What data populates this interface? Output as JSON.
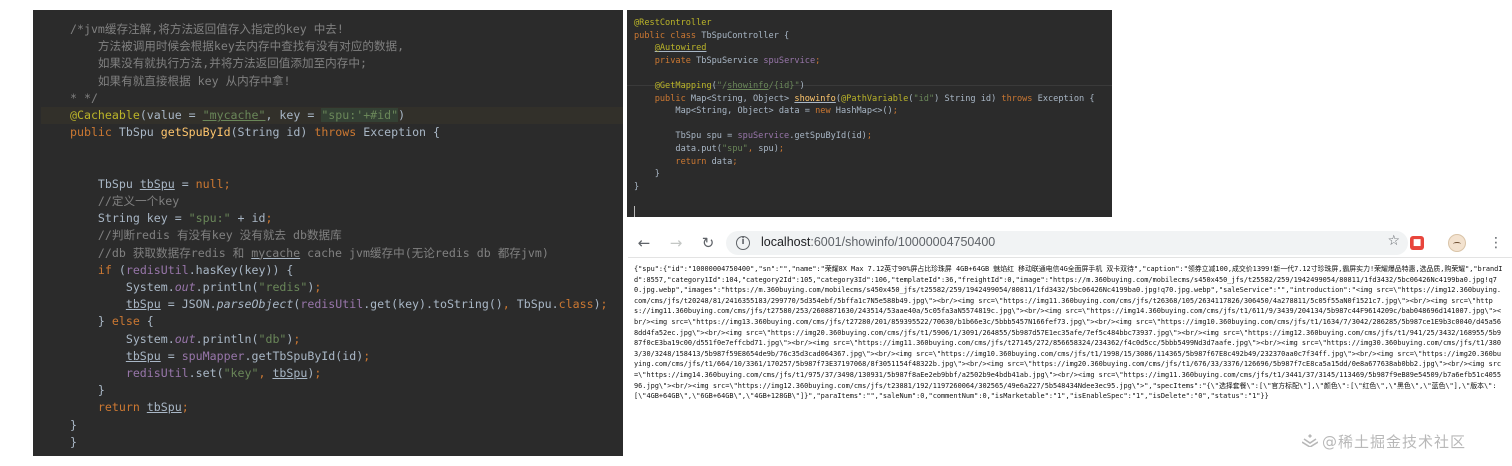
{
  "left_editor": {
    "lines": [
      {
        "parts": [
          {
            "t": "/*jvm缓存注解,将方法返回值存入指定的key 中去!",
            "c": "c-cmt"
          }
        ]
      },
      {
        "parts": [
          {
            "t": "    方法被调用时候会根据key去内存中查找有没有对应的数据,",
            "c": "c-cmt"
          }
        ]
      },
      {
        "parts": [
          {
            "t": "    如果没有就执行方法,并将方法返回值添加至内存中;",
            "c": "c-cmt"
          }
        ]
      },
      {
        "parts": [
          {
            "t": "    如果有就直接根据 key 从内存中拿!",
            "c": "c-cmt"
          }
        ]
      },
      {
        "parts": [
          {
            "t": "* */",
            "c": "c-cmt"
          }
        ]
      },
      {
        "parts": [
          {
            "t": "@Cacheable",
            "c": "c-ann"
          },
          {
            "t": "(value = ",
            "c": ""
          },
          {
            "t": "\"mycache\"",
            "c": "c-str c-ul-str"
          },
          {
            "t": ", key = ",
            "c": ""
          },
          {
            "t": "\"spu:'+#id\"",
            "c": "c-key"
          },
          {
            "t": ")",
            "c": ""
          }
        ]
      },
      {
        "parts": [
          {
            "t": "public ",
            "c": "c-kw"
          },
          {
            "t": "TbSpu ",
            "c": ""
          },
          {
            "t": "getSpuById",
            "c": "c-fn"
          },
          {
            "t": "(String id) ",
            "c": ""
          },
          {
            "t": "throws ",
            "c": "c-kw"
          },
          {
            "t": "Exception {",
            "c": ""
          }
        ]
      },
      {
        "parts": []
      },
      {
        "parts": []
      },
      {
        "parts": [
          {
            "t": "    TbSpu ",
            "c": ""
          },
          {
            "t": "tbSpu",
            "c": "c-ul"
          },
          {
            "t": " = ",
            "c": ""
          },
          {
            "t": "null",
            "c": "c-kw"
          },
          {
            "t": ";",
            "c": "c-kw"
          }
        ]
      },
      {
        "parts": [
          {
            "t": "    //定义一个key",
            "c": "c-cmt"
          }
        ]
      },
      {
        "parts": [
          {
            "t": "    String key = ",
            "c": ""
          },
          {
            "t": "\"spu:\"",
            "c": "c-str"
          },
          {
            "t": " + id",
            "c": ""
          },
          {
            "t": ";",
            "c": "c-kw"
          }
        ]
      },
      {
        "parts": [
          {
            "t": "    //判断redis 有没有key 没有就去 db数据库",
            "c": "c-cmt"
          }
        ]
      },
      {
        "parts": [
          {
            "t": "    //db 获取数据存redis 和 ",
            "c": "c-cmt"
          },
          {
            "t": "mycache",
            "c": "c-cmt c-ul"
          },
          {
            "t": " cache jvm缓存中(无论redis db 都存jvm)",
            "c": "c-cmt"
          }
        ]
      },
      {
        "parts": [
          {
            "t": "    ",
            "c": ""
          },
          {
            "t": "if ",
            "c": "c-kw"
          },
          {
            "t": "(",
            "c": ""
          },
          {
            "t": "redisUtil",
            "c": "c-fld"
          },
          {
            "t": ".hasKey(key)) {",
            "c": ""
          }
        ]
      },
      {
        "parts": [
          {
            "t": "        System.",
            "c": ""
          },
          {
            "t": "out",
            "c": "c-fld c-it"
          },
          {
            "t": ".println(",
            "c": ""
          },
          {
            "t": "\"redis\"",
            "c": "c-str"
          },
          {
            "t": ")",
            "c": ""
          },
          {
            "t": ";",
            "c": "c-kw"
          }
        ]
      },
      {
        "parts": [
          {
            "t": "        ",
            "c": ""
          },
          {
            "t": "tbSpu",
            "c": "c-ul"
          },
          {
            "t": " = JSON.",
            "c": ""
          },
          {
            "t": "parseObject",
            "c": "c-it"
          },
          {
            "t": "(",
            "c": ""
          },
          {
            "t": "redisUtil",
            "c": "c-fld"
          },
          {
            "t": ".get(key).toString()",
            "c": ""
          },
          {
            "t": ", ",
            "c": "c-kw"
          },
          {
            "t": "TbSpu.",
            "c": ""
          },
          {
            "t": "class",
            "c": "c-kw"
          },
          {
            "t": ")",
            "c": ""
          },
          {
            "t": ";",
            "c": "c-kw"
          }
        ]
      },
      {
        "parts": [
          {
            "t": "    } ",
            "c": ""
          },
          {
            "t": "else ",
            "c": "c-kw"
          },
          {
            "t": "{",
            "c": ""
          }
        ]
      },
      {
        "parts": [
          {
            "t": "        System.",
            "c": ""
          },
          {
            "t": "out",
            "c": "c-fld c-it"
          },
          {
            "t": ".println(",
            "c": ""
          },
          {
            "t": "\"db\"",
            "c": "c-str"
          },
          {
            "t": ")",
            "c": ""
          },
          {
            "t": ";",
            "c": "c-kw"
          }
        ]
      },
      {
        "parts": [
          {
            "t": "        ",
            "c": ""
          },
          {
            "t": "tbSpu",
            "c": "c-ul"
          },
          {
            "t": " = ",
            "c": ""
          },
          {
            "t": "spuMapper",
            "c": "c-fld"
          },
          {
            "t": ".getTbSpuById(id)",
            "c": ""
          },
          {
            "t": ";",
            "c": "c-kw"
          }
        ]
      },
      {
        "parts": [
          {
            "t": "        ",
            "c": ""
          },
          {
            "t": "redisUtil",
            "c": "c-fld"
          },
          {
            "t": ".set(",
            "c": ""
          },
          {
            "t": "\"key\"",
            "c": "c-str"
          },
          {
            "t": ", ",
            "c": "c-kw"
          },
          {
            "t": "tbSpu",
            "c": "c-ul"
          },
          {
            "t": ")",
            "c": ""
          },
          {
            "t": ";",
            "c": "c-kw"
          }
        ]
      },
      {
        "parts": [
          {
            "t": "    }",
            "c": ""
          }
        ]
      },
      {
        "parts": [
          {
            "t": "    ",
            "c": ""
          },
          {
            "t": "return ",
            "c": "c-kw"
          },
          {
            "t": "tbSpu",
            "c": "c-ul"
          },
          {
            "t": ";",
            "c": "c-kw"
          }
        ]
      },
      {
        "parts": [
          {
            "t": "}",
            "c": ""
          }
        ]
      },
      {
        "parts": [
          {
            "t": "}",
            "c": ""
          }
        ]
      }
    ]
  },
  "right_editor": {
    "lines": [
      {
        "parts": [
          {
            "t": "@RestController",
            "c": "c-ann"
          }
        ]
      },
      {
        "parts": [
          {
            "t": "public class ",
            "c": "c-kw"
          },
          {
            "t": "TbSpuController {",
            "c": ""
          }
        ]
      },
      {
        "parts": [
          {
            "t": "    ",
            "c": ""
          },
          {
            "t": "@Autowired",
            "c": "c-ann c-ul"
          }
        ]
      },
      {
        "parts": [
          {
            "t": "    ",
            "c": ""
          },
          {
            "t": "private ",
            "c": "c-kw"
          },
          {
            "t": "TbSpuService ",
            "c": ""
          },
          {
            "t": "spuService",
            "c": "c-fld"
          },
          {
            "t": ";",
            "c": "c-kw"
          }
        ]
      },
      {
        "parts": []
      },
      {
        "parts": [
          {
            "t": "    ",
            "c": ""
          },
          {
            "t": "@GetMapping",
            "c": "c-ann"
          },
          {
            "t": "(",
            "c": ""
          },
          {
            "t": "\"/",
            "c": "c-str"
          },
          {
            "t": "showinfo",
            "c": "c-str c-ul-str"
          },
          {
            "t": "/{id}\"",
            "c": "c-str"
          },
          {
            "t": ")",
            "c": ""
          }
        ]
      },
      {
        "parts": [
          {
            "t": "    ",
            "c": ""
          },
          {
            "t": "public ",
            "c": "c-kw"
          },
          {
            "t": "Map<String, Object> ",
            "c": ""
          },
          {
            "t": "showinfo",
            "c": "c-fn c-ul"
          },
          {
            "t": "(",
            "c": ""
          },
          {
            "t": "@PathVariable",
            "c": "c-ann"
          },
          {
            "t": "(",
            "c": ""
          },
          {
            "t": "\"id\"",
            "c": "c-str"
          },
          {
            "t": ") String id) ",
            "c": ""
          },
          {
            "t": "throws ",
            "c": "c-kw"
          },
          {
            "t": "Exception {",
            "c": ""
          }
        ]
      },
      {
        "parts": [
          {
            "t": "        Map<String, Object> data = ",
            "c": ""
          },
          {
            "t": "new ",
            "c": "c-kw"
          },
          {
            "t": "HashMap<>()",
            "c": ""
          },
          {
            "t": ";",
            "c": "c-kw"
          }
        ]
      },
      {
        "parts": []
      },
      {
        "parts": [
          {
            "t": "        TbSpu spu = ",
            "c": ""
          },
          {
            "t": "spuService",
            "c": "c-fld"
          },
          {
            "t": ".getSpuById(id)",
            "c": ""
          },
          {
            "t": ";",
            "c": "c-kw"
          }
        ]
      },
      {
        "parts": [
          {
            "t": "        data.put(",
            "c": ""
          },
          {
            "t": "\"spu\"",
            "c": "c-str"
          },
          {
            "t": ", ",
            "c": "c-kw"
          },
          {
            "t": "spu)",
            "c": ""
          },
          {
            "t": ";",
            "c": "c-kw"
          }
        ]
      },
      {
        "parts": [
          {
            "t": "        ",
            "c": ""
          },
          {
            "t": "return ",
            "c": "c-kw"
          },
          {
            "t": "data",
            "c": ""
          },
          {
            "t": ";",
            "c": "c-kw"
          }
        ]
      },
      {
        "parts": [
          {
            "t": "    }",
            "c": ""
          }
        ]
      },
      {
        "parts": [
          {
            "t": "}",
            "c": ""
          }
        ]
      }
    ]
  },
  "browser": {
    "url_host": "localhost",
    "url_path": ":6001/showinfo/10000004750400",
    "icons": {
      "back": "back-arrow-icon",
      "forward": "forward-arrow-icon",
      "reload": "reload-icon",
      "info": "site-info-icon",
      "bookmark": "bookmark-star-icon"
    },
    "json_text": "{\"spu\":{\"id\":\"10000004750400\",\"sn\":\"\",\"name\":\"荣耀8X Max 7.12英寸90%屏占比珍珠屏 4GB+64GB 魅焰红 移动联通电信4G全面屏手机 双卡双待\",\"caption\":\"领券立减100,成交价1399!新一代7.12寸珍珠屏,霸屏实力!荣耀爆品特惠,选品质,购荣耀\",\"brandId\":8557,\"category1Id\":104,\"category2Id\":105,\"category3Id\":106,\"templateId\":36,\"freightId\":0,\"image\":\"https://m.360buying.com/mobilecms/s450x450_jfs/t25582/259/1942499054/80811/1fd3432/5bc06426Nc4199ba0.jpg!q70.jpg.webp\",\"images\":\"https://m.360buying.com/mobilecms/s450x450_jfs/t25582/259/1942499054/80811/1fd3432/5bc06426Nc4199ba0.jpg!q70.jpg.webp\",\"saleService\":\"\",\"introduction\":\"<img src=\\\"https://img12.360buying.com/cms/jfs/t20248/81/2416355183/299770/5d354ebf/5bffa1c7N5e588b49.jpg\\\"><br/><img src=\\\"https://img11.360buying.com/cms/jfs/t26368/105/2634117826/306450/4a278811/5c05f55aN0f1521c7.jpg\\\"><br/><img src=\\\"https://img11.360buying.com/cms/jfs/t27580/253/2608871630/243514/53aae40a/5c05fa3aN5574819c.jpg\\\"><br/><img src=\\\"https://img14.360buying.com/cms/jfs/t1/611/9/3439/204134/5b987c44F9614209c/bab048696d141007.jpg\\\"><br/><img src=\\\"https://img13.360buying.com/cms/jfs/t27280/201/859395522/70630/b1b66e3c/5bbb5457N166fef73.jpg\\\"><br/><img src=\\\"https://img10.360buying.com/cms/jfs/t1/1634/7/3042/286285/5b987ce1E9b3c0040/d45a568dd4fa52ec.jpg\\\"><br/><img src=\\\"https://img20.360buying.com/cms/jfs/t1/5906/1/3091/264855/5b987d57E1ec35afe/7ef5c484bbc73937.jpg\\\"><br/><img src=\\\"https://img12.360buying.com/cms/jfs/t1/941/25/3432/168955/5b987f0cE3ba19c00/d551f0e7effcbd71.jpg\\\"><br/><img src=\\\"https://img11.360buying.com/cms/jfs/t27145/272/856658324/234362/f4c0d5cc/5bbb5499Nd3d7aafe.jpg\\\"><br/><img src=\\\"https://img30.360buying.com/cms/jfs/t1/3803/30/3248/158413/5b987f59E8654de9b/76c35d3cad064367.jpg\\\"><br/><img src=\\\"https://img10.360buying.com/cms/jfs/t1/1998/15/3086/114365/5b987f67E8c492b49/232370aa0c7f34ff.jpg\\\"><br/><img src=\\\"https://img20.360buying.com/cms/jfs/t1/664/10/3361/170257/5b987f73E37197068/8f3051154f48322b.jpg\\\"><br/><img src=\\\"https://img20.360buying.com/cms/jfs/t1/676/33/3376/126696/5b987f7cE8ca5a15dd/0e8a677638ab0bb2.jpg\\\"><br/><img src=\\\"https://img14.360buying.com/cms/jfs/t1/975/37/3498/130931/5b987f8aEe2eb9bbf/a2502b9e4bdb41ab.jpg\\\"><br/><img src=\\\"https://img11.360buying.com/cms/jfs/t1/3441/37/3145/113469/5b987f9eB89e54509/b7a6efb51c405596.jpg\\\"><br/><img src=\\\"https://img12.360buying.com/cms/jfs/t23881/192/1197260064/302565/49e6a227/5b548434Ndee3ec95.jpg\\\">\",\"specItems\":\"{\\\"选择套餐\\\":[\\\"官方标配\\\"],\\\"颜色\\\":[\\\"红色\\\",\\\"黑色\\\",\\\"蓝色\\\"],\\\"版本\\\":[\\\"4GB+64GB\\\",\\\"6GB+64GB\\\",\\\"4GB+128GB\\\"]}\",\"paraItems\":\"\",\"saleNum\":0,\"commentNum\":0,\"isMarketable\":\"1\",\"isEnableSpec\":\"1\",\"isDelete\":\"0\",\"status\":\"1\"}}"
  },
  "watermark": {
    "text": "@稀土掘金技术社区"
  }
}
